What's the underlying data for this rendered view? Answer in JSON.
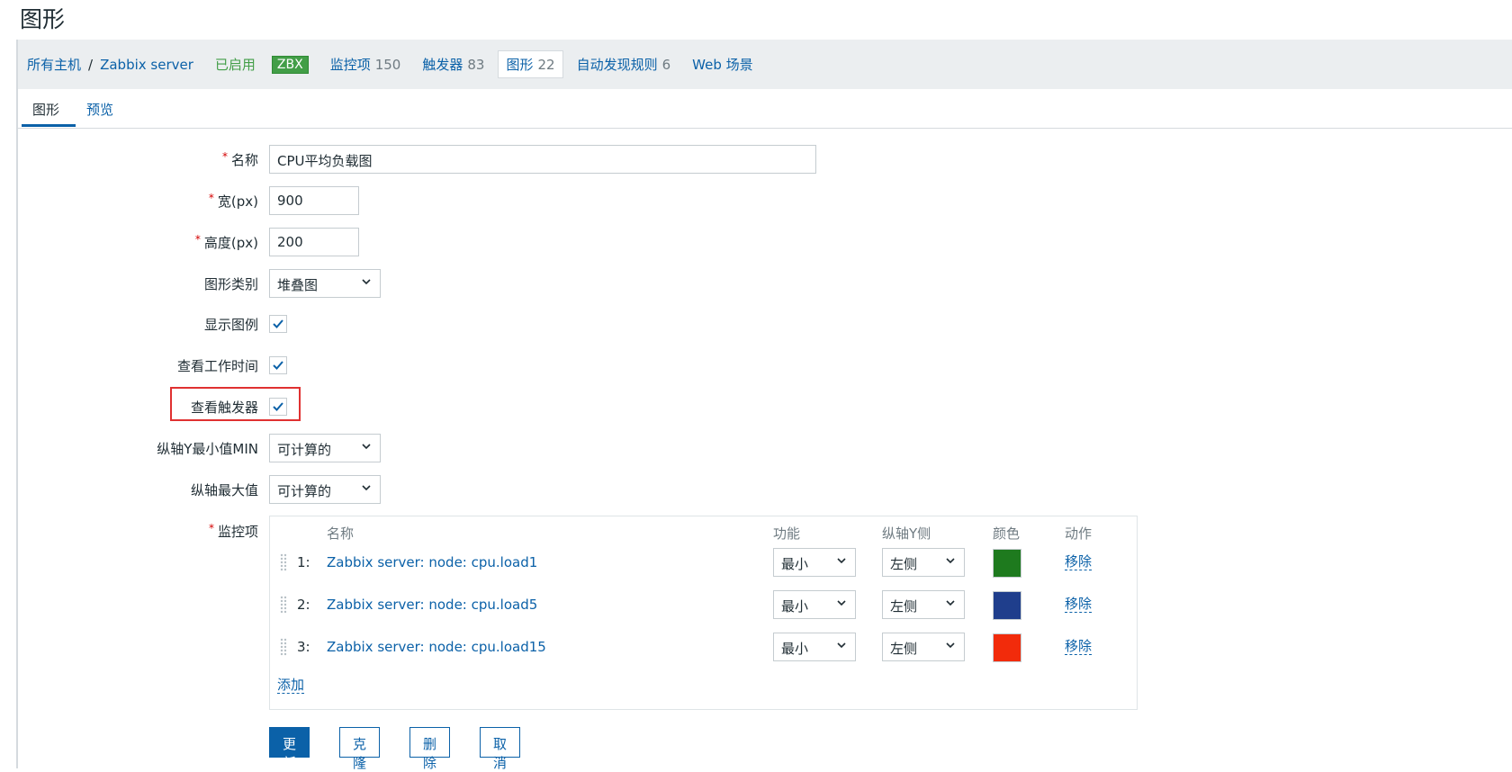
{
  "page": {
    "title": "图形"
  },
  "breadcrumb": {
    "all_hosts": "所有主机",
    "separator": "/",
    "host": "Zabbix server",
    "status": "已启用",
    "agent_badge": "ZBX",
    "items_label": "监控项",
    "items_count": "150",
    "triggers_label": "触发器",
    "triggers_count": "83",
    "graphs_label": "图形",
    "graphs_count": "22",
    "discovery_label": "自动发现规则",
    "discovery_count": "6",
    "web_label": "Web 场景"
  },
  "tabs": {
    "graph": "图形",
    "preview": "预览"
  },
  "form": {
    "name_label": "名称",
    "name_value": "CPU平均负载图",
    "width_label": "宽(px)",
    "width_value": "900",
    "height_label": "高度(px)",
    "height_value": "200",
    "graph_type_label": "图形类别",
    "graph_type_value": "堆叠图",
    "show_legend_label": "显示图例",
    "show_legend_checked": true,
    "show_work_period_label": "查看工作时间",
    "show_work_period_checked": true,
    "show_triggers_label": "查看触发器",
    "show_triggers_checked": true,
    "ymin_label": "纵轴Y最小值MIN",
    "ymin_value": "可计算的",
    "ymax_label": "纵轴最大值",
    "ymax_value": "可计算的",
    "items_label": "监控项"
  },
  "items_table": {
    "headers": {
      "name": "名称",
      "function": "功能",
      "y_axis_side": "纵轴Y侧",
      "color": "颜色",
      "action": "动作"
    },
    "rows": [
      {
        "num": "1:",
        "name": "Zabbix server: node: cpu.load1",
        "function": "最小",
        "side": "左侧",
        "color": "#1e7a1e",
        "action": "移除"
      },
      {
        "num": "2:",
        "name": "Zabbix server: node: cpu.load5",
        "function": "最小",
        "side": "左侧",
        "color": "#1f3e8c",
        "action": "移除"
      },
      {
        "num": "3:",
        "name": "Zabbix server: node: cpu.load15",
        "function": "最小",
        "side": "左侧",
        "color": "#f22b0b",
        "action": "移除"
      }
    ],
    "add_label": "添加"
  },
  "buttons": {
    "update": "更新",
    "clone": "克隆",
    "delete": "删除",
    "cancel": "取消"
  },
  "colors": {
    "accent": "#0b61a8",
    "enabled": "#429e47",
    "highlight": "#e03131"
  }
}
